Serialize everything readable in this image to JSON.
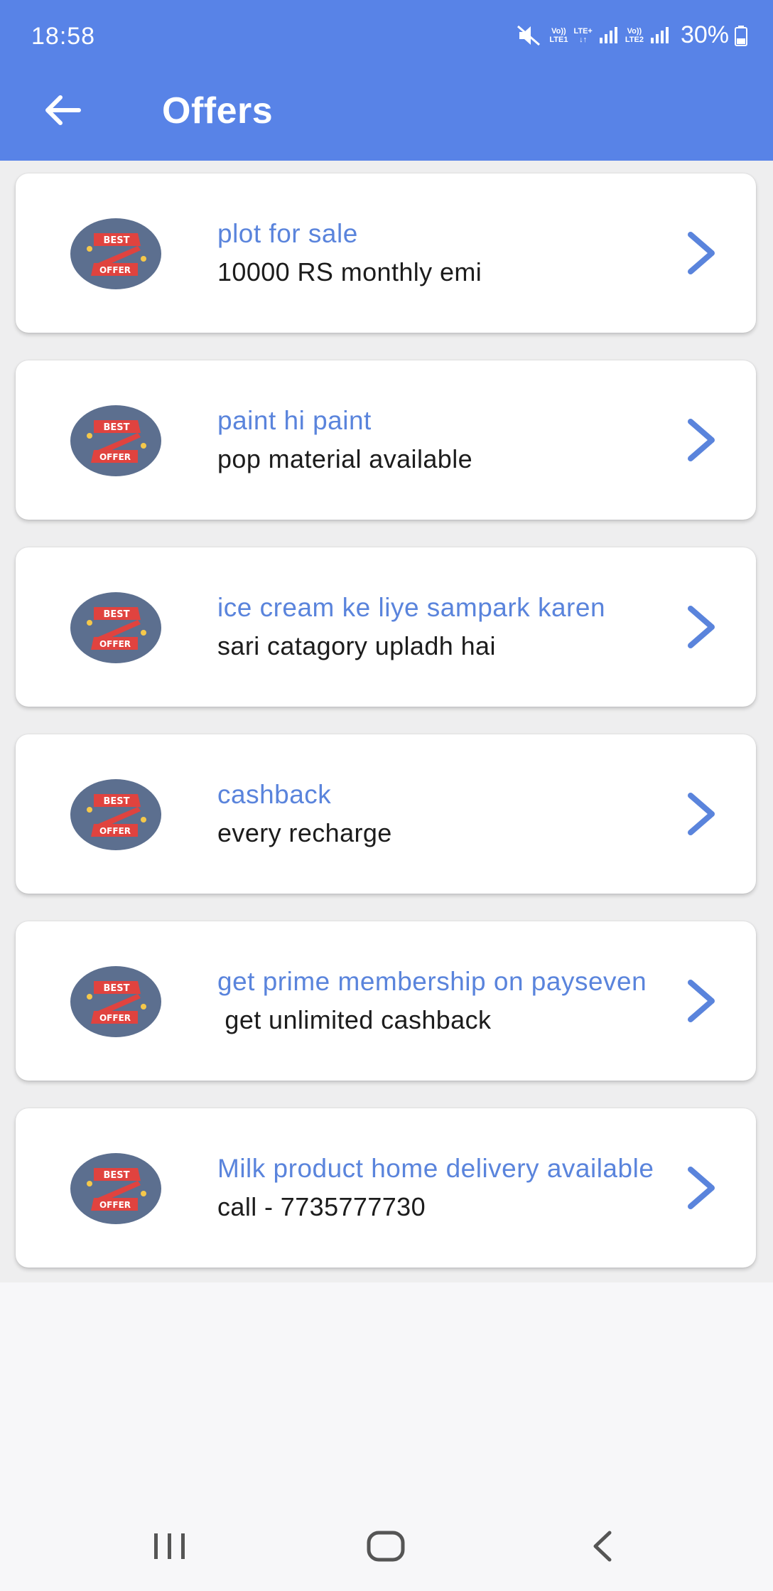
{
  "status_bar": {
    "time": "18:58",
    "net1_top": "Vo))",
    "net1_bottom": "LTE1",
    "net1_type": "LTE+",
    "net2_top": "Vo))",
    "net2_bottom": "LTE2",
    "battery": "30%",
    "icons": [
      "mute-icon",
      "signal-icon",
      "signal-icon",
      "battery-icon"
    ]
  },
  "app_bar": {
    "title": "Offers",
    "back_icon": "arrow-left-icon"
  },
  "colors": {
    "primary": "#5883e7",
    "title_text": "#5a84dc",
    "badge_bg": "#5c6f8f",
    "badge_ribbon": "#e0433f"
  },
  "offers": [
    {
      "title": "plot for sale",
      "subtitle": "10000 RS monthly emi",
      "badge": "best-offer-badge"
    },
    {
      "title": "paint hi paint",
      "subtitle": "pop material available",
      "badge": "best-offer-badge"
    },
    {
      "title": "ice cream ke liye sampark karen",
      "subtitle": "sari catagory upladh hai",
      "badge": "best-offer-badge"
    },
    {
      "title": "cashback",
      "subtitle": "every recharge",
      "badge": "best-offer-badge"
    },
    {
      "title": "get prime membership on payseven",
      "subtitle": " get unlimited cashback",
      "badge": "best-offer-badge"
    },
    {
      "title": "Milk product home delivery available",
      "subtitle": "call - 7735777730",
      "badge": "best-offer-badge"
    }
  ],
  "nav_bar": {
    "buttons": [
      "recent-apps-icon",
      "home-icon",
      "back-icon"
    ]
  }
}
